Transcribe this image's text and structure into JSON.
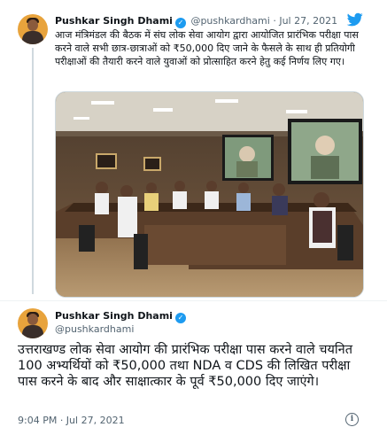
{
  "tweet1": {
    "author_name": "Pushkar Singh Dhami",
    "handle": "@pushkardhami",
    "separator": "·",
    "date": "Jul 27, 2021",
    "text": "आज मंत्रिमंडल की बैठक में संघ लोक सेवा आयोग द्वारा आयोजित प्रारंभिक परीक्षा पास करने वाले सभी छात्र-छात्राओं को ₹50,000 दिए जाने के फैसले के साथ ही प्रतियोगी परीक्षाओं की तैयारी करने वाले युवाओं को प्रोत्साहित करने हेतु कई निर्णय लिए गए।"
  },
  "tweet2": {
    "author_name": "Pushkar Singh Dhami",
    "handle": "@pushkardhami",
    "text": "उत्तराखण्ड लोक सेवा आयोग की प्रारंभिक परीक्षा पास करने वाले चयनित 100 अभ्यर्थियों को ₹50,000 तथा NDA व CDS की लिखित परीक्षा पास करने के बाद और साक्षात्कार के पूर्व ₹50,000 दिए जाएंगे।",
    "timestamp": "9:04 PM · Jul 27, 2021"
  },
  "icons": {
    "brand": "twitter-bird-icon",
    "verified": "verified-badge-icon",
    "info": "info-icon"
  },
  "colors": {
    "twitter_blue": "#1d9bf0",
    "muted_text": "#536471",
    "border": "#cfd9de"
  }
}
